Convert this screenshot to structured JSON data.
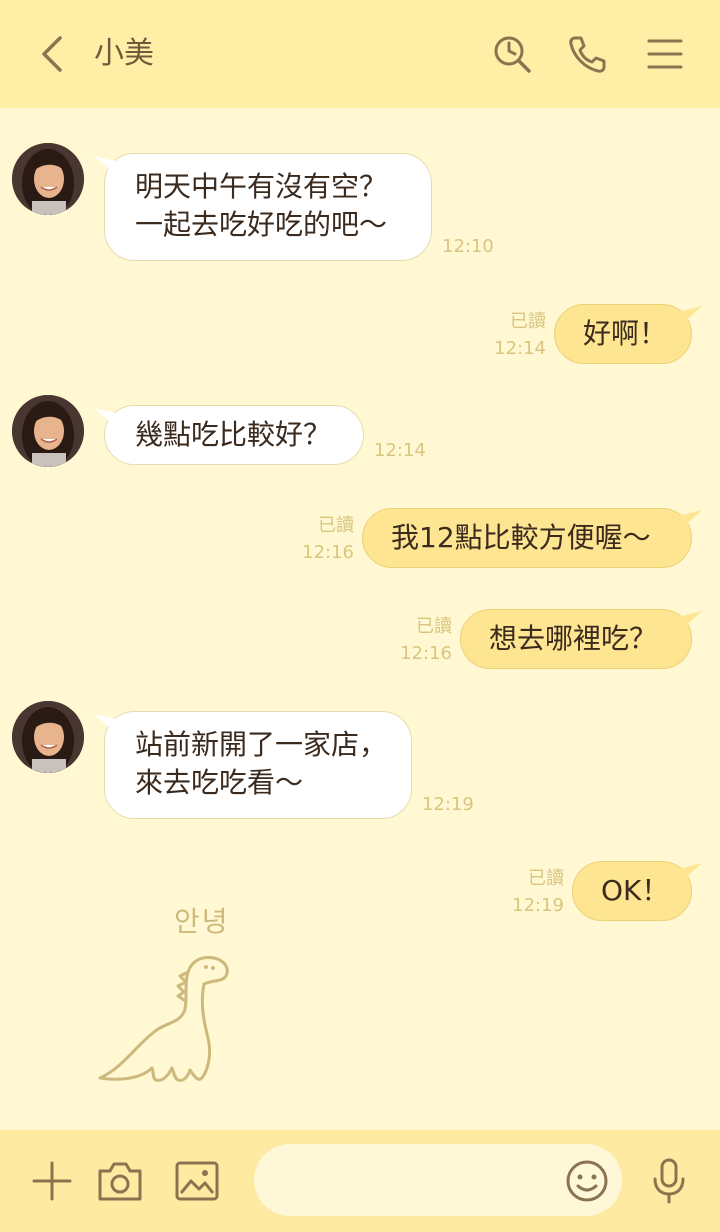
{
  "header": {
    "contact_name": "小美",
    "icons": [
      "back-icon",
      "search-icon",
      "phone-icon",
      "menu-icon"
    ]
  },
  "messages": [
    {
      "side": "in",
      "lines": [
        "明天中午有沒有空？",
        "一起去吃好吃的吧～"
      ],
      "time": "12:10"
    },
    {
      "side": "out",
      "lines": [
        "好啊！"
      ],
      "read": "已讀",
      "time": "12:14"
    },
    {
      "side": "in",
      "lines": [
        "幾點吃比較好？"
      ],
      "time": "12:14"
    },
    {
      "side": "out",
      "lines": [
        "我12點比較方便喔～"
      ],
      "read": "已讀",
      "time": "12:16"
    },
    {
      "side": "out",
      "lines": [
        "想去哪裡吃？"
      ],
      "read": "已讀",
      "time": "12:16"
    },
    {
      "side": "in",
      "lines": [
        "站前新開了一家店，",
        "來去吃吃看～"
      ],
      "time": "12:19"
    },
    {
      "side": "out",
      "lines": [
        "OK！"
      ],
      "read": "已讀",
      "time": "12:19"
    }
  ],
  "sticker": {
    "text": "안녕",
    "icon": "dinosaur-sticker"
  },
  "input_bar": {
    "placeholder": "",
    "icons": [
      "plus-icon",
      "camera-icon",
      "image-icon",
      "emoji-icon",
      "microphone-icon"
    ]
  },
  "colors": {
    "header_bg": "#FEEFA6",
    "chat_bg": "#FFF8D2",
    "outgoing_bubble": "#FEE592",
    "incoming_bubble": "#FFFFFF",
    "icon_color": "#8A7450",
    "meta_text": "#D9C57E"
  }
}
